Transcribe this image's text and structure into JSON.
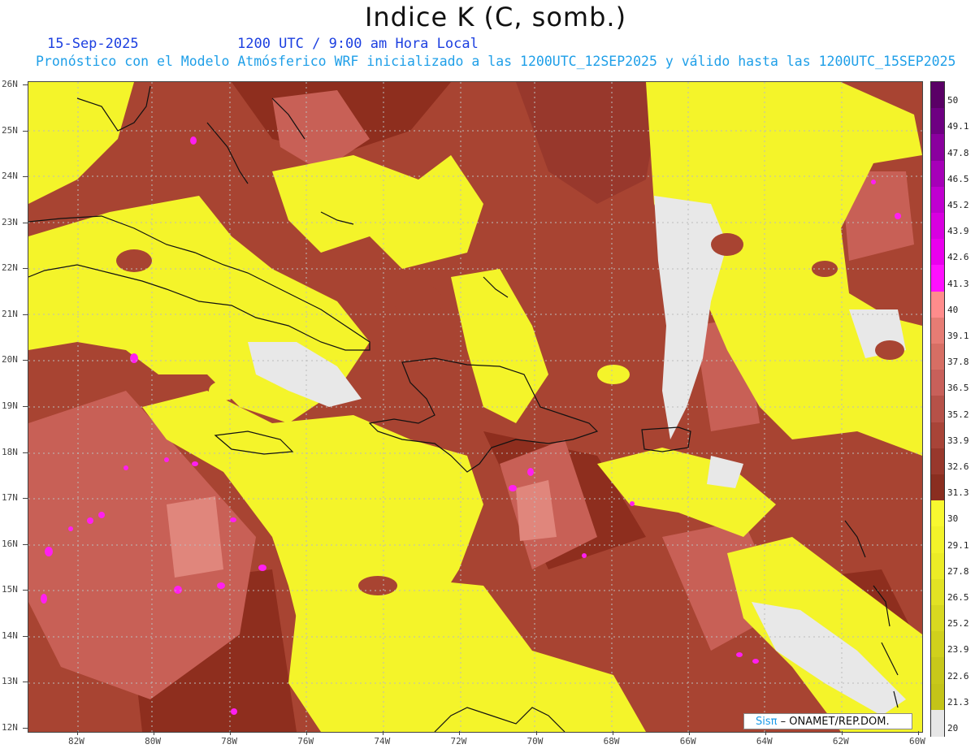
{
  "header": {
    "title": "Indice K (C, somb.)",
    "date": "15-Sep-2025",
    "time": "1200 UTC / 9:00 am Hora Local",
    "subtitle": "Pronóstico con el Modelo Atmósferico WRF inicializado a las 1200UTC_12SEP2025 y válido hasta las  1200UTC_15SEP2025"
  },
  "map": {
    "region": "Caribbean",
    "lat_labels": [
      "26N",
      "25N",
      "24N",
      "23N",
      "22N",
      "21N",
      "20N",
      "19N",
      "18N",
      "17N",
      "16N",
      "15N",
      "14N",
      "13N",
      "12N"
    ],
    "lon_labels": [
      "82W",
      "80W",
      "78W",
      "76W",
      "74W",
      "72W",
      "70W",
      "68W",
      "66W",
      "64W",
      "62W",
      "60W"
    ],
    "colors": {
      "low": "#e8e8e8",
      "yellow": "#f4f42a",
      "brown_dark": "#8e2e1e",
      "brown_mid": "#a84432",
      "salmon": "#d0685c",
      "pink": "#e0867c",
      "magenta": "#ff1ff0",
      "coast": "#111111",
      "grid": "#bbbbbb"
    }
  },
  "legend": {
    "labels": [
      "50",
      "49.1",
      "47.8",
      "46.5",
      "45.2",
      "43.9",
      "42.6",
      "41.3",
      "40",
      "39.1",
      "37.8",
      "36.5",
      "35.2",
      "33.9",
      "32.6",
      "31.3",
      "30",
      "29.1",
      "27.8",
      "26.5",
      "25.2",
      "23.9",
      "22.6",
      "21.3",
      "20"
    ],
    "colors": [
      "#5a0066",
      "#6e0082",
      "#8a009e",
      "#a600b8",
      "#c000d0",
      "#d800e0",
      "#ea00ee",
      "#ff10ff",
      "#ff8c8c",
      "#e67c74",
      "#d66e64",
      "#c8605a",
      "#b65148",
      "#a84438",
      "#98382c",
      "#8a2e20",
      "#f8f830",
      "#f2f22a",
      "#ecec26",
      "#e2e224",
      "#d8d820",
      "#d0d01c",
      "#c8c81a",
      "#c4c418",
      "#e6e6e6"
    ]
  },
  "credit": {
    "logo": "Sisπ",
    "org": "– ONAMET/REP.DOM."
  }
}
